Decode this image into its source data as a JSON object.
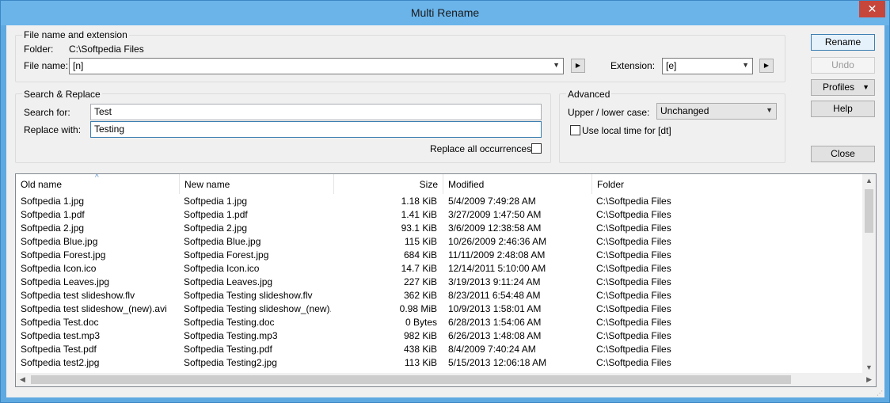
{
  "window": {
    "title": "Multi Rename",
    "close_glyph": "✕"
  },
  "file_group": {
    "label": "File name and extension",
    "folder_label": "Folder:",
    "folder_value": "C:\\Softpedia Files",
    "filename_label": "File name:",
    "filename_value": "[n]",
    "extension_label": "Extension:",
    "extension_value": "[e]"
  },
  "search_group": {
    "label": "Search & Replace",
    "search_label": "Search for:",
    "search_value": "Test",
    "replace_label": "Replace with:",
    "replace_value": "Testing",
    "replace_all_label": "Replace all occurrences",
    "replace_all_checked": false
  },
  "advanced_group": {
    "label": "Advanced",
    "case_label": "Upper / lower case:",
    "case_value": "Unchanged",
    "local_time_label": "Use local time for [dt]",
    "local_time_checked": false
  },
  "buttons": {
    "rename": "Rename",
    "undo": "Undo",
    "profiles": "Profiles",
    "help": "Help",
    "close": "Close"
  },
  "table": {
    "columns": [
      "Old name",
      "New name",
      "Size",
      "Modified",
      "Folder"
    ],
    "sort_indicator": "^",
    "rows": [
      [
        "Softpedia 1.jpg",
        "Softpedia 1.jpg",
        "1.18 KiB",
        "5/4/2009  7:49:28 AM",
        "C:\\Softpedia Files"
      ],
      [
        "Softpedia 1.pdf",
        "Softpedia 1.pdf",
        "1.41 KiB",
        "3/27/2009  1:47:50 AM",
        "C:\\Softpedia Files"
      ],
      [
        "Softpedia 2.jpg",
        "Softpedia 2.jpg",
        "93.1 KiB",
        "3/6/2009  12:38:58 AM",
        "C:\\Softpedia Files"
      ],
      [
        "Softpedia Blue.jpg",
        "Softpedia Blue.jpg",
        "115 KiB",
        "10/26/2009  2:46:36 AM",
        "C:\\Softpedia Files"
      ],
      [
        "Softpedia Forest.jpg",
        "Softpedia Forest.jpg",
        "684 KiB",
        "11/11/2009  2:48:08 AM",
        "C:\\Softpedia Files"
      ],
      [
        "Softpedia Icon.ico",
        "Softpedia Icon.ico",
        "14.7 KiB",
        "12/14/2011  5:10:00 AM",
        "C:\\Softpedia Files"
      ],
      [
        "Softpedia Leaves.jpg",
        "Softpedia Leaves.jpg",
        "227 KiB",
        "3/19/2013  9:11:24 AM",
        "C:\\Softpedia Files"
      ],
      [
        "Softpedia test slideshow.flv",
        "Softpedia Testing slideshow.flv",
        "362 KiB",
        "8/23/2011  6:54:48 AM",
        "C:\\Softpedia Files"
      ],
      [
        "Softpedia test slideshow_(new).avi",
        "Softpedia Testing slideshow_(new)...",
        "0.98 MiB",
        "10/9/2013  1:58:01 AM",
        "C:\\Softpedia Files"
      ],
      [
        "Softpedia Test.doc",
        "Softpedia Testing.doc",
        "0 Bytes",
        "6/28/2013  1:54:06 AM",
        "C:\\Softpedia Files"
      ],
      [
        "Softpedia test.mp3",
        "Softpedia Testing.mp3",
        "982 KiB",
        "6/26/2013  1:48:08 AM",
        "C:\\Softpedia Files"
      ],
      [
        "Softpedia Test.pdf",
        "Softpedia Testing.pdf",
        "438 KiB",
        "8/4/2009  7:40:24 AM",
        "C:\\Softpedia Files"
      ],
      [
        "Softpedia test2.jpg",
        "Softpedia Testing2.jpg",
        "113 KiB",
        "5/15/2013  12:06:18 AM",
        "C:\\Softpedia Files"
      ]
    ]
  }
}
